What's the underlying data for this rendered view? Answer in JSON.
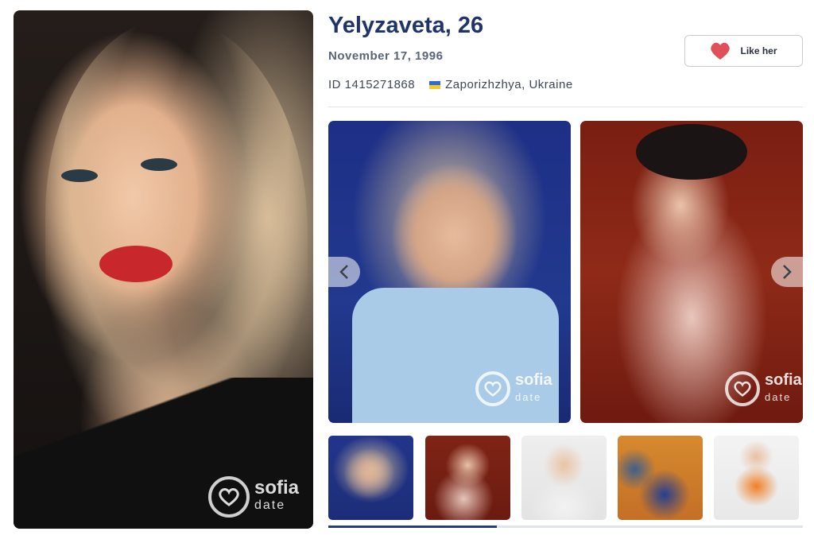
{
  "profile": {
    "name_age": "Yelyzaveta, 26",
    "birth_date": "November 17, 1996",
    "id_text": "ID 1415271868",
    "location": "Zaporizhzhya, Ukraine",
    "flag_icon": "ukraine-flag-icon"
  },
  "actions": {
    "like_label": "Like her",
    "like_icon": "heart-icon",
    "heart_color": "#e0505a"
  },
  "watermark": {
    "brand_top": "sofia",
    "brand_bottom": "date"
  },
  "gallery": {
    "photos": [
      "photo-blue-sweater",
      "photo-red-background"
    ],
    "thumbnails": [
      "thumb-blue",
      "thumb-red",
      "thumb-white-shirt",
      "thumb-boxing-autumn",
      "thumb-boxing-orange"
    ],
    "prev_icon": "chevron-left-icon",
    "next_icon": "chevron-right-icon"
  },
  "colors": {
    "title": "#1f3468",
    "accent": "#2a3c7c"
  }
}
